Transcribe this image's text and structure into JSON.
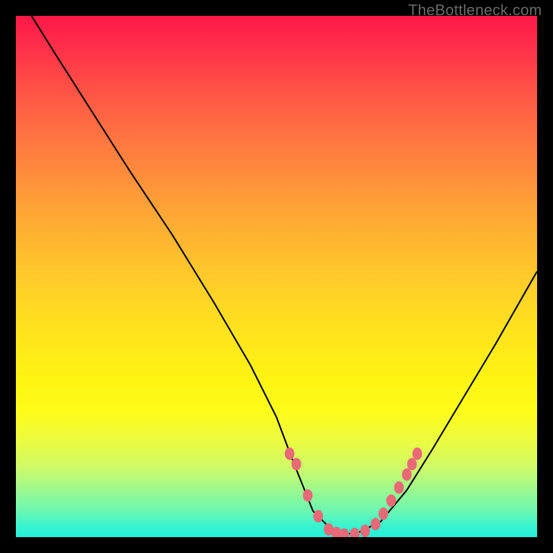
{
  "watermark": "TheBottleneck.com",
  "chart_data": {
    "type": "line",
    "title": "",
    "xlabel": "",
    "ylabel": "",
    "x_range": [
      0,
      100
    ],
    "y_range": [
      0,
      100
    ],
    "series": [
      {
        "name": "curve",
        "x": [
          3,
          8,
          15,
          22,
          30,
          38,
          45,
          50,
          53,
          55,
          57,
          60,
          63,
          66,
          70,
          75,
          80,
          86,
          92,
          100
        ],
        "y": [
          100,
          92,
          81,
          70,
          58,
          45,
          33,
          23,
          15,
          10,
          5,
          2,
          0.5,
          1,
          3,
          9,
          17,
          27,
          37,
          51
        ]
      }
    ],
    "markers": {
      "name": "highlight-points",
      "x": [
        52.5,
        53.8,
        56.0,
        58.0,
        60.0,
        61.5,
        63.0,
        65.0,
        67.0,
        69.0,
        70.5,
        72.0,
        73.5,
        75.0,
        76.0,
        77.0
      ],
      "y": [
        16,
        14,
        8,
        4,
        1.5,
        0.8,
        0.5,
        0.6,
        1.2,
        2.5,
        4.5,
        7,
        9.5,
        12,
        14,
        16
      ]
    },
    "marker_color": "#e96977",
    "line_color": "#000000"
  }
}
